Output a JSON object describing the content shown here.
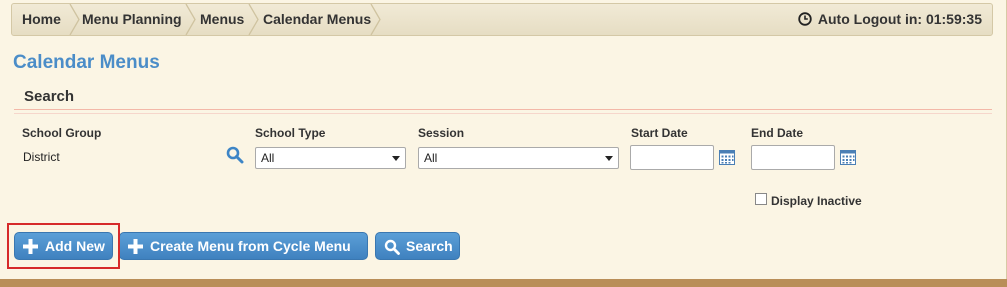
{
  "breadcrumb": {
    "items": [
      "Home",
      "Menu Planning",
      "Menus",
      "Calendar Menus"
    ],
    "auto_logout": "Auto Logout in: 01:59:35"
  },
  "page": {
    "title": "Calendar Menus",
    "section": "Search"
  },
  "filters": {
    "school_group": {
      "label": "School Group",
      "value": "District"
    },
    "school_type": {
      "label": "School Type",
      "selected": "All"
    },
    "session": {
      "label": "Session",
      "selected": "All"
    },
    "start_date": {
      "label": "Start Date",
      "value": ""
    },
    "end_date": {
      "label": "End Date",
      "value": ""
    },
    "display_inactive": {
      "label": "Display Inactive",
      "checked": false
    }
  },
  "actions": {
    "add_new": "Add New",
    "create_from_cycle": "Create Menu from Cycle Menu",
    "search": "Search"
  },
  "colors": {
    "accent": "#4b8dc8",
    "button": "#4a8cc9",
    "highlight": "#d62a2a"
  }
}
